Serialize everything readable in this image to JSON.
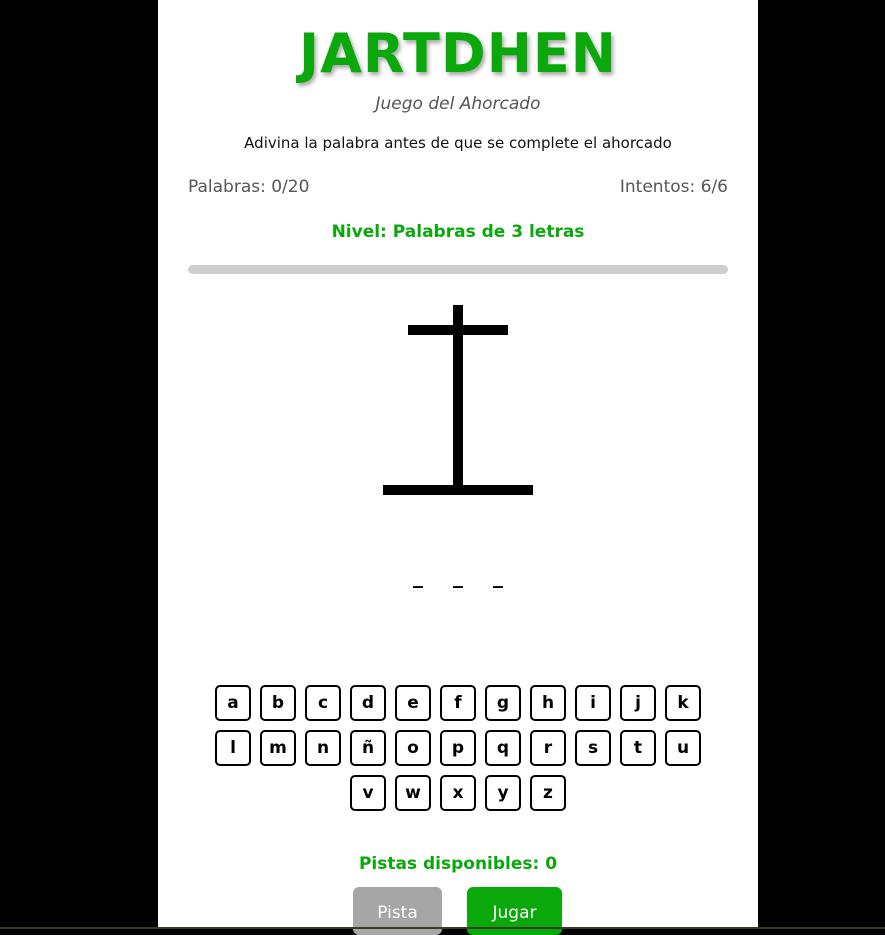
{
  "header": {
    "title": "JARTDHEN",
    "subtitle": "Juego del Ahorcado",
    "description": "Adivina la palabra antes de que se complete el ahorcado"
  },
  "stats": {
    "words": "Palabras: 0/20",
    "attempts": "Intentos: 6/6"
  },
  "level": "Nivel: Palabras de 3 letras",
  "progress": {
    "value": 0,
    "max": 20
  },
  "word_slots": [
    "_",
    "_",
    "_"
  ],
  "keyboard": {
    "rows": [
      [
        "a",
        "b",
        "c",
        "d",
        "e",
        "f",
        "g",
        "h",
        "i",
        "j",
        "k"
      ],
      [
        "l",
        "m",
        "n",
        "ñ",
        "o",
        "p",
        "q",
        "r",
        "s",
        "t",
        "u"
      ],
      [
        "v",
        "w",
        "x",
        "y",
        "z"
      ]
    ]
  },
  "hints_label": "Pistas disponibles: 0",
  "buttons": {
    "hint": "Pista",
    "play": "Jugar"
  },
  "colors": {
    "accent": "#0aa80a",
    "disabled": "#a6a6a6",
    "background": "#000000"
  }
}
